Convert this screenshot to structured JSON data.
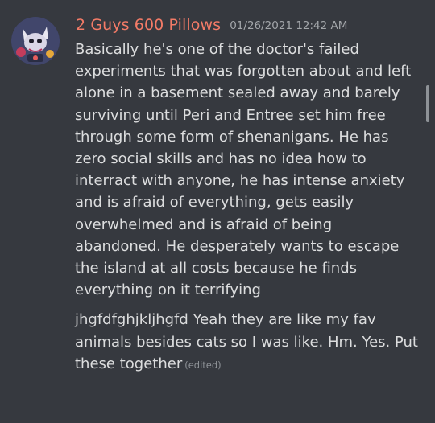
{
  "message": {
    "author": "2 Guys 600 Pillows",
    "timestamp": "01/26/2021 12:42 AM",
    "lines": [
      "Basically he's one of the doctor's failed experiments that was forgotten about and left alone in a basement sealed away and barely surviving until Peri and Entree set him free through some form of shenanigans. He has zero social skills and has no idea how to interract with anyone, he has intense anxiety and is afraid of everything, gets easily overwhelmed and is afraid of being abandoned. He desperately wants to escape the island at all costs because he finds everything on it terrifying",
      "jhgfdfghjkljhgfd Yeah they are like my fav animals besides cats so I was like. Hm. Yes. Put these together"
    ],
    "edited_label": "(edited)"
  },
  "colors": {
    "background": "#36393f",
    "username": "#f47b67",
    "text": "#dcddde",
    "timestamp": "#a3a6aa"
  }
}
